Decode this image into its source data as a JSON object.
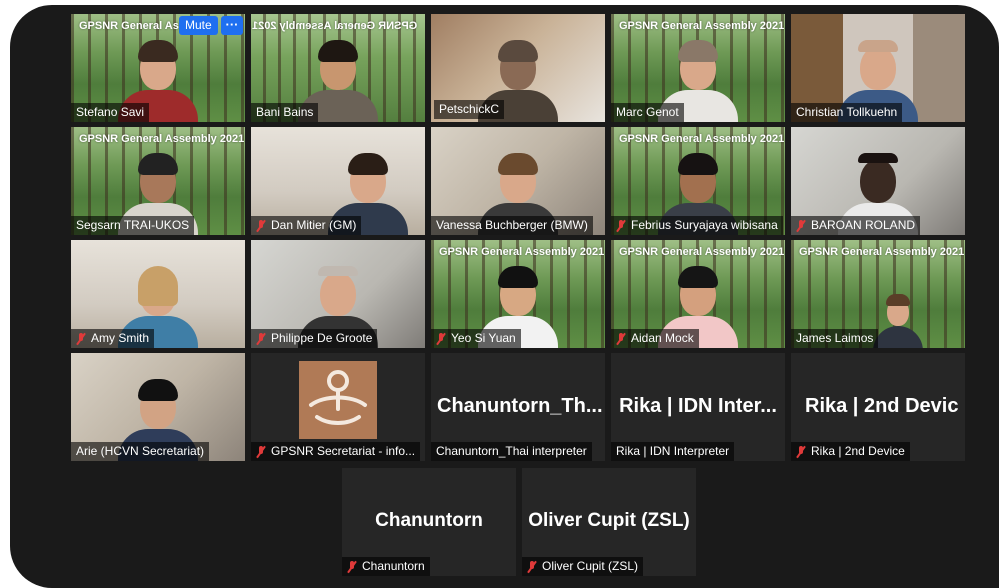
{
  "meeting": {
    "banner_text": "GPSNR General Assembly 2021",
    "banner_short": "GPSNR General Ass",
    "banner_flipped": "GPSNR General Assembly 2021",
    "hover_controls": {
      "mute_label": "Mute",
      "more_label": "···"
    },
    "participants": [
      {
        "display_name": "Stefano Savi",
        "muted": false
      },
      {
        "display_name": "Bani Bains",
        "muted": false
      },
      {
        "display_name": "PetschickC",
        "muted": false,
        "active_speaker": true
      },
      {
        "display_name": "Marc Genot",
        "muted": false
      },
      {
        "display_name": "Christian Tollkuehn",
        "muted": false
      },
      {
        "display_name": "Segsarn TRAI-UKOS",
        "muted": false
      },
      {
        "display_name": "Dan Mitier (GM)",
        "muted": true
      },
      {
        "display_name": "Vanessa Buchberger (BMW)",
        "muted": false
      },
      {
        "display_name": "Febrius Suryajaya wibisana",
        "muted": true
      },
      {
        "display_name": "BAROAN ROLAND",
        "muted": true
      },
      {
        "display_name": "Amy Smith",
        "muted": true
      },
      {
        "display_name": "Philippe De Groote",
        "muted": true
      },
      {
        "display_name": "Yeo Si Yuan",
        "muted": true
      },
      {
        "display_name": "Aidan Mock",
        "muted": true
      },
      {
        "display_name": "James Laimos",
        "muted": false
      },
      {
        "display_name": "Arie (HCVN Secretariat)",
        "muted": false
      },
      {
        "display_name": "GPSNR Secretariat - info...",
        "muted": true
      },
      {
        "display_name": "Chanuntorn_Thai interpreter",
        "muted": false,
        "big_label": "Chanuntorn_Th..."
      },
      {
        "display_name": "Rika | IDN Interpreter",
        "muted": false,
        "big_label": "Rika | IDN Inter..."
      },
      {
        "display_name": "Rika | 2nd Device",
        "muted": true,
        "big_label": "Rika | 2nd Devic"
      },
      {
        "display_name": "Chanuntorn",
        "muted": true,
        "big_label": "Chanuntorn"
      },
      {
        "display_name": "Oliver Cupit (ZSL)",
        "muted": true,
        "big_label": "Oliver Cupit (ZSL)"
      }
    ]
  },
  "colors": {
    "background": "#1a1a1a",
    "active_speaker_border": "#e6f07a",
    "mute_button": "#1f6ff0",
    "muted_icon": "#e03a3a"
  }
}
